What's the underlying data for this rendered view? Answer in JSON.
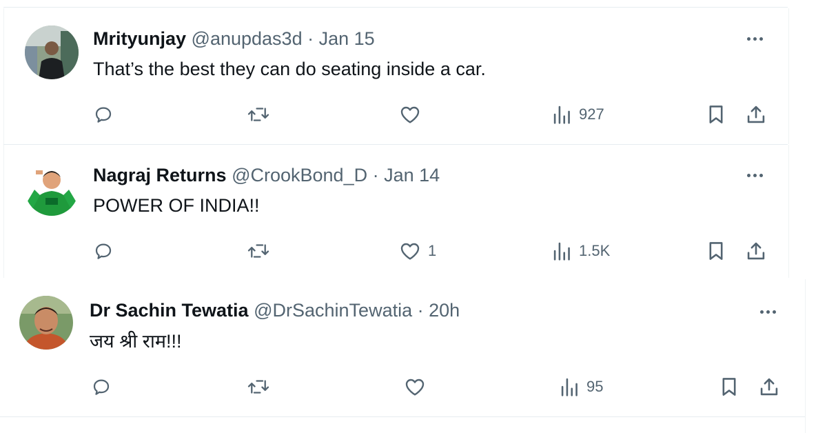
{
  "tweets": [
    {
      "name": "Mrityunjay",
      "handle": "@anupdas3d",
      "date": "Jan 15",
      "text": "That’s the best they can do seating inside a car.",
      "actions": {
        "replies": "",
        "reposts": "",
        "likes": "",
        "views": "927"
      }
    },
    {
      "name": "Nagraj Returns",
      "handle": "@CrookBond_D",
      "date": "Jan 14",
      "text": "POWER OF INDIA!!",
      "actions": {
        "replies": "",
        "reposts": "",
        "likes": "1",
        "views": "1.5K"
      }
    },
    {
      "name": "Dr Sachin Tewatia",
      "handle": "@DrSachinTewatia",
      "date": "20h",
      "text": "जय श्री राम!!!",
      "actions": {
        "replies": "",
        "reposts": "",
        "likes": "",
        "views": "95"
      }
    }
  ],
  "separator": "·",
  "icons": [
    "reply-icon",
    "repost-icon",
    "like-icon",
    "views-icon",
    "bookmark-icon",
    "share-icon",
    "more-icon"
  ],
  "colors": {
    "text": "#0f1419",
    "secondary": "#536471",
    "border": "#eff3f4"
  }
}
